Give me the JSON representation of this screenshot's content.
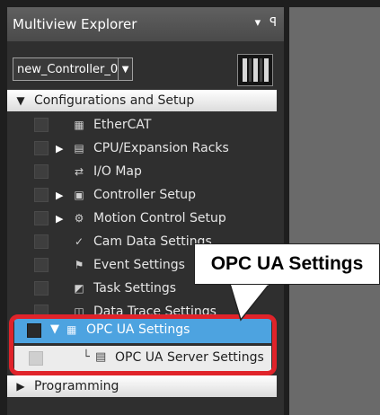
{
  "explorer": {
    "title": "Multiview Explorer",
    "pin_glyph": "⌄ ꟼ",
    "controller_select": {
      "value": "new_Controller_0"
    }
  },
  "tree": {
    "section_configurations": "Configurations and Setup",
    "section_programming": "Programming",
    "items": [
      {
        "label": "EtherCAT",
        "icon": "ethercat-icon"
      },
      {
        "label": "CPU/Expansion Racks",
        "icon": "rack-icon",
        "expandable": true
      },
      {
        "label": "I/O Map",
        "icon": "io-map-icon"
      },
      {
        "label": "Controller Setup",
        "icon": "controller-setup-icon",
        "expandable": true
      },
      {
        "label": "Motion Control Setup",
        "icon": "motion-gear-icon",
        "expandable": true
      },
      {
        "label": "Cam Data Settings",
        "icon": "cam-icon"
      },
      {
        "label": "Event Settings",
        "icon": "flag-icon"
      },
      {
        "label": "Task Settings",
        "icon": "task-icon"
      },
      {
        "label": "Data Trace Settings",
        "icon": "trace-icon"
      }
    ],
    "selected_item": {
      "label": "OPC UA Settings",
      "icon": "opc-ua-icon",
      "expanded": true
    },
    "sub_item": {
      "label": "OPC UA Server Settings",
      "icon": "server-settings-icon"
    }
  },
  "callout": {
    "text": "OPC UA Settings"
  },
  "colors": {
    "selection": "#4da3e0",
    "highlight": "#e0232a",
    "panel": "#2f2f2f"
  }
}
